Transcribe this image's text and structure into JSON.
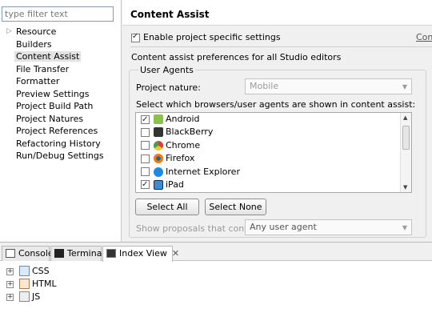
{
  "sidebar": {
    "filter_placeholder": "type filter text",
    "items": [
      {
        "label": "Resource",
        "expandable": true
      },
      {
        "label": "Builders",
        "expandable": false
      },
      {
        "label": "Content Assist",
        "expandable": false,
        "selected": true
      },
      {
        "label": "File Transfer",
        "expandable": false
      },
      {
        "label": "Formatter",
        "expandable": false
      },
      {
        "label": "Preview Settings",
        "expandable": false
      },
      {
        "label": "Project Build Path",
        "expandable": false
      },
      {
        "label": "Project Natures",
        "expandable": false
      },
      {
        "label": "Project References",
        "expandable": false
      },
      {
        "label": "Refactoring History",
        "expandable": false
      },
      {
        "label": "Run/Debug Settings",
        "expandable": false
      }
    ]
  },
  "page": {
    "title": "Content Assist",
    "enable_label": "Enable project specific settings",
    "enable_checked": true,
    "configure_link": "Configure Workspace Settings...",
    "description": "Content assist preferences for all Studio editors",
    "user_agents": {
      "group_title": "User Agents",
      "project_nature_label": "Project nature:",
      "project_nature_value": "Mobile",
      "browsers_label": "Select which browsers/user agents are shown in content assist:",
      "browsers": [
        {
          "label": "Android",
          "checked": true,
          "icon": "android-icon",
          "color": "#8bc34a"
        },
        {
          "label": "BlackBerry",
          "checked": false,
          "icon": "blackberry-icon",
          "color": "#333333"
        },
        {
          "label": "Chrome",
          "checked": false,
          "icon": "chrome-icon",
          "color": "#e53935"
        },
        {
          "label": "Firefox",
          "checked": false,
          "icon": "firefox-icon",
          "color": "#f57c00"
        },
        {
          "label": "Internet Explorer",
          "checked": false,
          "icon": "internet-explorer-icon",
          "color": "#1e88e5"
        },
        {
          "label": "iPad",
          "checked": true,
          "icon": "ipad-icon",
          "color": "#3b8ed0"
        }
      ],
      "select_all_label": "Select All",
      "select_none_label": "Select None",
      "show_proposals_label": "Show proposals that contain:",
      "show_proposals_value": "Any user agent"
    }
  },
  "bottom": {
    "tabs": [
      {
        "label": "Console",
        "icon": "console-icon"
      },
      {
        "label": "Terminal",
        "icon": "terminal-icon"
      },
      {
        "label": "Index View",
        "icon": "index-view-icon",
        "active": true
      }
    ],
    "tree": [
      {
        "label": "CSS",
        "icon": "css-file-icon"
      },
      {
        "label": "HTML",
        "icon": "html-file-icon"
      },
      {
        "label": "JS",
        "icon": "js-file-icon"
      }
    ]
  }
}
